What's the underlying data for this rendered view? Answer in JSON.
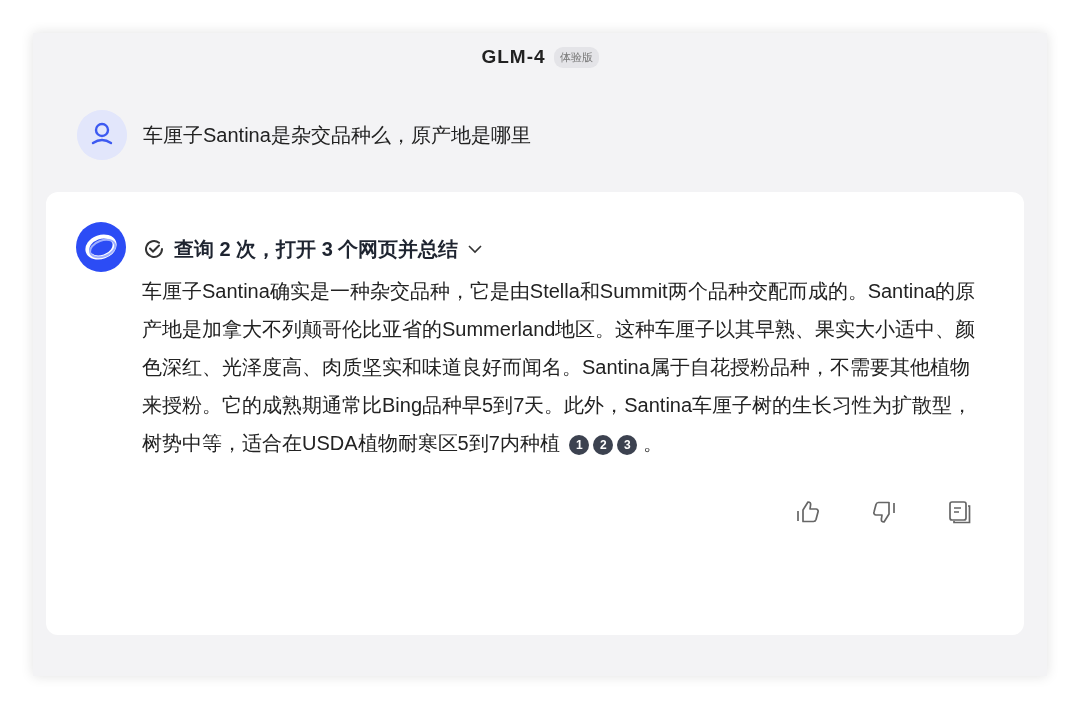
{
  "header": {
    "title": "GLM-4",
    "badge": "体验版"
  },
  "question": {
    "text": "车厘子Santina是杂交品种么，原产地是哪里"
  },
  "answer": {
    "search_summary": "查询 2 次，打开 3 个网页并总结",
    "expanded": false,
    "text": "车厘子Santina确实是一种杂交品种，它是由Stella和Summit两个品种交配而成的。Santina的原产地是加拿大不列颠哥伦比亚省的Summerland地区。这种车厘子以其早熟、果实大小适中、颜色深红、光泽度高、肉质坚实和味道良好而闻名。Santina属于自花授粉品种，不需要其他植物来授粉。它的成熟期通常比Bing品种早5到7天。此外，Santina车厘子树的生长习性为扩散型，树势中等，适合在USDA植物耐寒区5到7内种植",
    "citations": [
      "1",
      "2",
      "3"
    ],
    "ending": "。"
  }
}
